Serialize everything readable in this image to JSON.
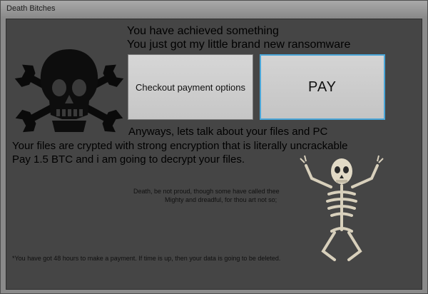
{
  "window": {
    "title": "Death Bitches"
  },
  "header": {
    "line1": "You have achieved something",
    "line2": "You just got my little brand new ransomware"
  },
  "buttons": {
    "checkout_label": "Checkout payment options",
    "pay_label": "PAY"
  },
  "body": {
    "line1": "Anyways, lets talk about your files and PC",
    "line2": "Your files are crypted with strong encryption  that is literally uncrackable",
    "line3": "Pay 1.5 BTC and i am going to decrypt your files."
  },
  "poem": {
    "line1": "Death, be not proud, though some have called thee",
    "line2": "Mighty and dreadful, for thou art not so;"
  },
  "footer": {
    "notice": "*You have got 48 hours to make a payment. If time is up, then your data is going to be deleted."
  },
  "images": {
    "logo": "skull-and-wrenches-icon",
    "figure": "skeleton-image"
  },
  "colors": {
    "background": "#454545",
    "pay_border": "#4aa6d8"
  }
}
